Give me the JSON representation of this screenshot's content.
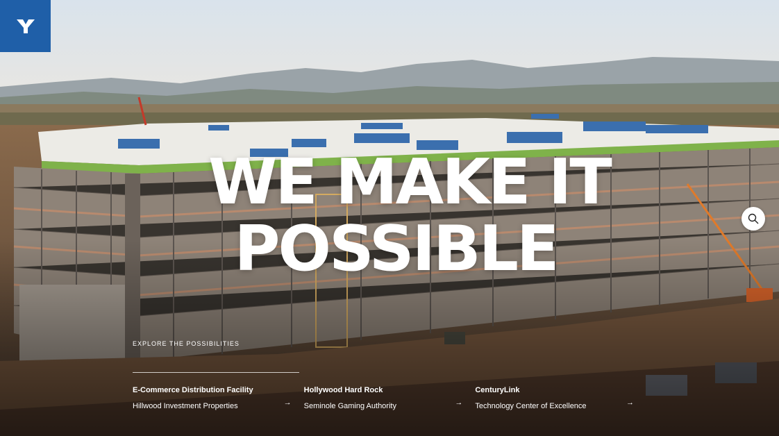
{
  "brand": {
    "logo_letter": "Y",
    "accent_color": "#1f5fa8"
  },
  "hero": {
    "headline_line1": "WE MAKE IT",
    "headline_line2": "POSSIBLE"
  },
  "explore": {
    "label": "EXPLORE THE POSSIBILITIES"
  },
  "projects": [
    {
      "title": "E-Commerce Distribution Facility",
      "client": "Hillwood Investment Properties",
      "arrow": "→"
    },
    {
      "title": "Hollywood Hard Rock",
      "client": "Seminole Gaming Authority",
      "arrow": "→"
    },
    {
      "title": "CenturyLink",
      "client": "Technology Center of Excellence",
      "arrow": "→"
    }
  ],
  "icons": {
    "search": "search-icon",
    "logo": "logo-icon"
  }
}
